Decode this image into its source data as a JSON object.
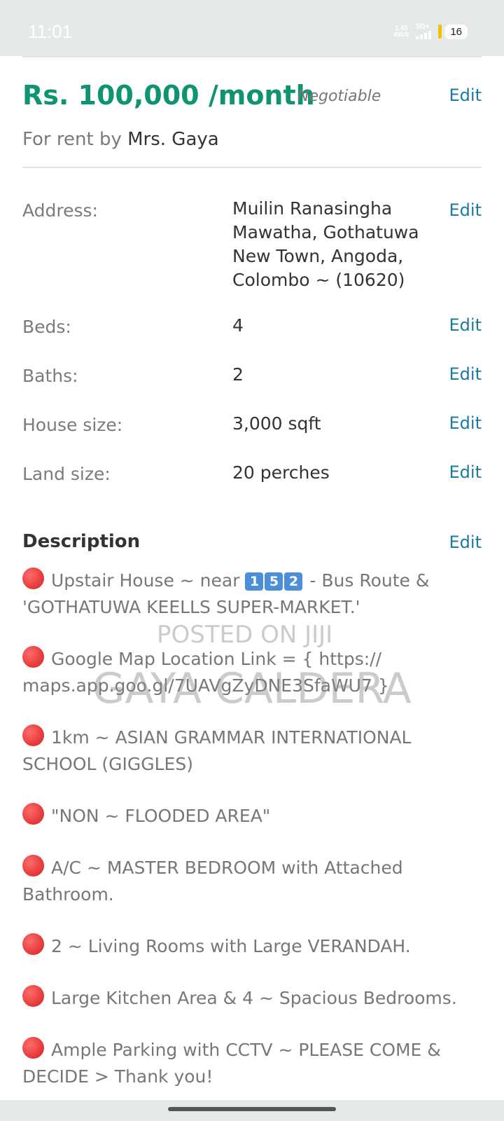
{
  "status_bar": {
    "time": "11:01",
    "net_speed_value": "1.43",
    "net_speed_unit": "KB/S",
    "network": "5G+",
    "battery": "16"
  },
  "listing": {
    "price": "Rs. 100,000 /month",
    "negotiable": "Negotiable",
    "rent_prefix": "For rent by",
    "owner": "Mrs. Gaya",
    "edit_label": "Edit"
  },
  "details": [
    {
      "label": "Address:",
      "value": "Muilin Ranasingha Mawatha, Gothatuwa New Town, Angoda, Colombo ~ (10620)"
    },
    {
      "label": "Beds:",
      "value": "4"
    },
    {
      "label": "Baths:",
      "value": "2"
    },
    {
      "label": "House size:",
      "value": "3,000 sqft"
    },
    {
      "label": "Land size:",
      "value": "20 perches"
    }
  ],
  "description": {
    "title": "Description",
    "items": [
      {
        "pre": "Upstair House ~ near",
        "keycaps": [
          "1",
          "5",
          "2"
        ],
        "text": "- Bus Route & 'GOTHATUWA KEELLS SUPER-MARKET.'"
      },
      {
        "text": "Google Map Location Link = { https:// maps.app.goo.gl/7UAVgZyDNE3SfaWU7 }"
      },
      {
        "text": "1km ~ ASIAN GRAMMAR INTERNATIONAL SCHOOL (GIGGLES)"
      },
      {
        "text": "\"NON ~ FLOODED AREA\""
      },
      {
        "text": "A/C ~ MASTER BEDROOM with Attached Bathroom."
      },
      {
        "text": "2 ~ Living Rooms with Large VERANDAH."
      },
      {
        "text": "Large Kitchen Area & 4 ~ Spacious Bedrooms."
      },
      {
        "text": "Ample Parking with CCTV ~ PLEASE COME & DECIDE > Thank you!"
      }
    ]
  },
  "watermark": {
    "line1": "POSTED ON JIJI",
    "line2": "GAYA CALDERA"
  }
}
